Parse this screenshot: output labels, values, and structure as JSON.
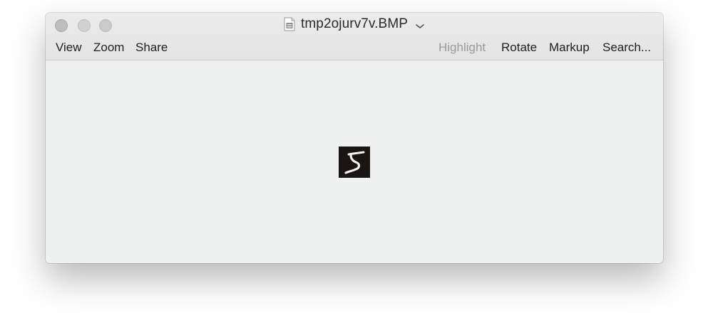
{
  "window": {
    "title": "tmp2ojurv7v.BMP",
    "icons": {
      "document": "bmp-document-icon",
      "title_menu": "chevron-down-icon",
      "close": "close-button",
      "minimize": "minimize-button",
      "zoom": "zoom-button"
    }
  },
  "toolbar": {
    "left": [
      "View",
      "Zoom",
      "Share"
    ],
    "right": [
      {
        "label": "Highlight",
        "enabled": false
      },
      {
        "label": "Rotate",
        "enabled": true
      },
      {
        "label": "Markup",
        "enabled": true
      },
      {
        "label": "Search...",
        "enabled": true
      }
    ]
  },
  "content": {
    "image": "handwritten-digit-five-image"
  },
  "colors": {
    "window_bg": "#eff0f0",
    "titlebar_bg": "#e3e3e3",
    "disabled_text": "#9b9b9b",
    "image_bg": "#1a1413"
  }
}
